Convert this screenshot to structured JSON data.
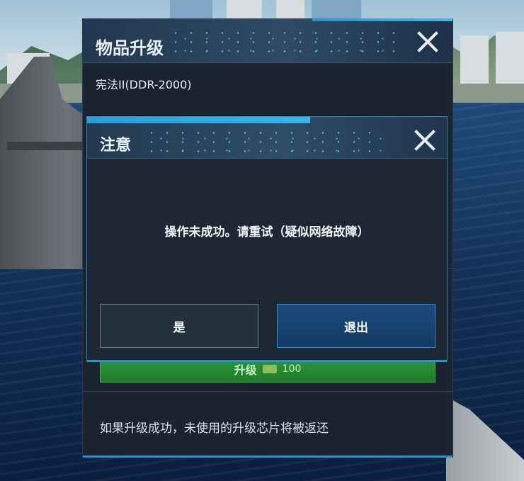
{
  "main_panel": {
    "title": "物品升级",
    "item_name": "宪法II(DDR-2000)",
    "upgrade_button": {
      "label": "升级",
      "cost": "100"
    },
    "footer_note": "如果升级成功，未使用的升级芯片将被返还"
  },
  "dialog": {
    "title": "注意",
    "message": "操作未成功。请重试（疑似网络故障）",
    "yes_label": "是",
    "exit_label": "退出"
  },
  "colors": {
    "accent": "#2d8fc7",
    "upgrade_green": "#2f9a3a",
    "exit_button": "#1c4a7c"
  }
}
